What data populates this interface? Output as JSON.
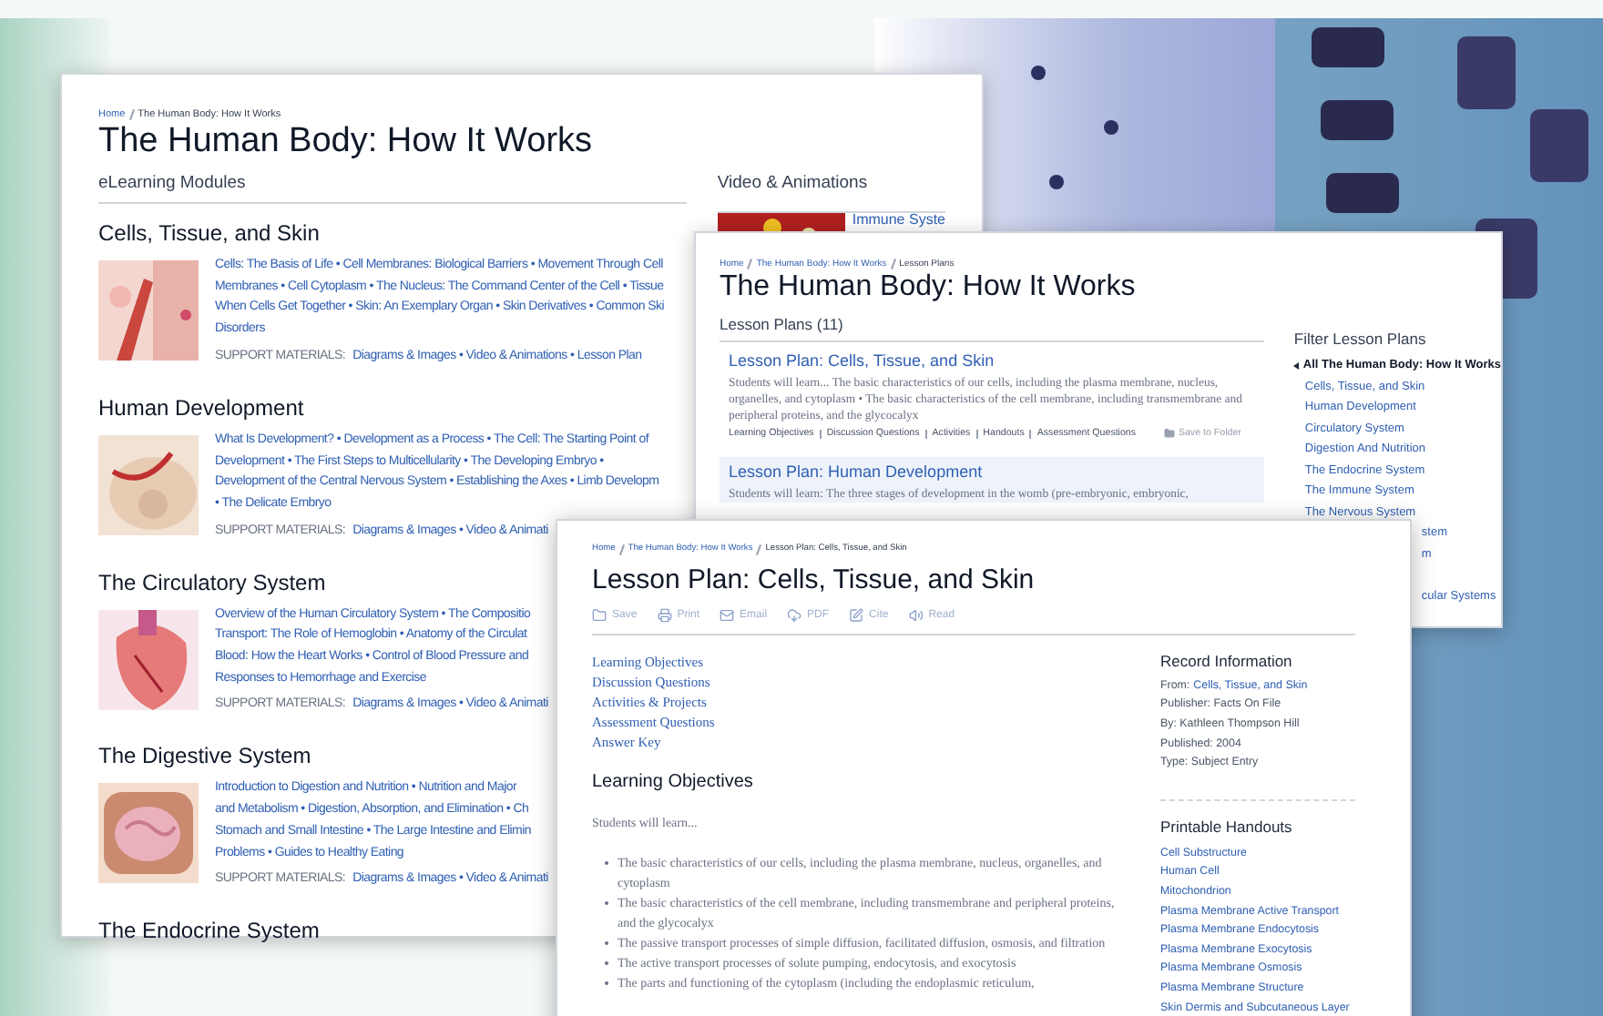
{
  "modules_page": {
    "breadcrumb": [
      {
        "label": "Home",
        "link": true
      },
      {
        "label": "The Human Body: How It Works",
        "link": false
      }
    ],
    "title": "The Human Body: How It Works",
    "section_title": "eLearning Modules",
    "modules": [
      {
        "title": "Cells, Tissue, and Skin",
        "lines": [
          "Cells: The Basis of Life • Cell Membranes: Biological Barriers • Movement Through Cell",
          "Membranes • Cell Cytoplasm • The Nucleus: The Command Center of the Cell • Tissue",
          "When Cells Get Together • Skin: An Exemplary Organ • Skin Derivatives • Common Ski",
          "Disorders"
        ],
        "support_label": "SUPPORT MATERIALS:",
        "support_links": "Diagrams & Images • Video & Animations • Lesson Plan"
      },
      {
        "title": "Human Development",
        "lines": [
          "What Is Development? • Development as a Process • The Cell: The Starting Point of",
          "Development • The First Steps to Multicellularity • The Developing Embryo •",
          "Development of the Central Nervous System • Establishing the Axes • Limb Developm",
          "• The Delicate Embryo"
        ],
        "support_label": "SUPPORT MATERIALS:",
        "support_links": "Diagrams & Images • Video & Animati"
      },
      {
        "title": "The Circulatory System",
        "lines": [
          "Overview of the Human Circulatory System • The Compositio",
          "Transport: The Role of Hemoglobin • Anatomy of the Circulat",
          "Blood: How the Heart Works • Control of Blood Pressure and",
          "Responses to Hemorrhage and Exercise"
        ],
        "support_label": "SUPPORT MATERIALS:",
        "support_links": "Diagrams & Images • Video & Animati"
      },
      {
        "title": "The Digestive System",
        "lines": [
          "Introduction to Digestion and Nutrition • Nutrition and Major",
          "and Metabolism • Digestion, Absorption, and Elimination • Ch",
          "Stomach and Small Intestine • The Large Intestine and Elimin",
          "Problems • Guides to Healthy Eating"
        ],
        "support_label": "SUPPORT MATERIALS:",
        "support_links": "Diagrams & Images • Video & Animati"
      },
      {
        "title": "The Endocrine System"
      }
    ],
    "side_title": "Video & Animations",
    "video_link": "Immune Syste"
  },
  "lesson_plans_page": {
    "breadcrumb": [
      {
        "label": "Home",
        "link": true
      },
      {
        "label": "The Human Body: How It Works",
        "link": true
      },
      {
        "label": "Lesson Plans",
        "link": false
      }
    ],
    "title": "The Human Body: How It Works",
    "list_title": "Lesson Plans (11)",
    "plans": [
      {
        "title": "Lesson Plan: Cells, Tissue, and Skin",
        "description": "Students will learn...  The basic characteristics of our cells, including the plasma membrane, nucleus, organelles, and cytoplasm • The basic characteristics of the cell membrane, including transmembrane and peripheral proteins, and the glycocalyx",
        "links": [
          "Learning Objectives",
          "Discussion Questions",
          "Activities",
          "Handouts",
          "Assessment Questions"
        ],
        "save": "Save to Folder",
        "selected": false
      },
      {
        "title": "Lesson Plan: Human Development",
        "description": "Students will learn: The three stages of development in the womb (pre-embryonic, embryonic,",
        "selected": true
      }
    ],
    "filter_title": "Filter Lesson Plans",
    "filters": [
      {
        "label": "All The Human Body: How It Works",
        "selected": true
      },
      {
        "label": "Cells, Tissue, and Skin",
        "selected": false
      },
      {
        "label": "Human Development",
        "selected": false
      },
      {
        "label": "Circulatory System",
        "selected": false
      },
      {
        "label": "Digestion And Nutrition",
        "selected": false
      },
      {
        "label": "The Endocrine System",
        "selected": false
      },
      {
        "label": "The Immune System",
        "selected": false
      },
      {
        "label": "The Nervous System",
        "selected": false
      },
      {
        "label": "stem",
        "selected": false
      },
      {
        "label": "m",
        "selected": false
      },
      {
        "label": "cular Systems",
        "selected": false
      }
    ]
  },
  "lesson_page": {
    "breadcrumb": [
      {
        "label": "Home",
        "link": true
      },
      {
        "label": "The Human Body: How It Works",
        "link": true
      },
      {
        "label": "Lesson Plan: Cells, Tissue, and Skin",
        "link": false
      }
    ],
    "title": "Lesson Plan: Cells, Tissue, and Skin",
    "tools": [
      "Save",
      "Print",
      "Email",
      "PDF",
      "Cite",
      "Read"
    ],
    "contents": [
      "Learning Objectives",
      "Discussion Questions",
      "Activities & Projects",
      "Assessment Questions",
      "Answer Key"
    ],
    "section_title": "Learning Objectives",
    "intro": "Students will learn...",
    "objectives": [
      "The basic characteristics of our cells, including the plasma membrane, nucleus, organelles, and cytoplasm",
      "The basic characteristics of the cell membrane, including transmembrane and peripheral proteins, and the glycocalyx",
      "The passive transport processes of simple diffusion, facilitated diffusion, osmosis, and filtration",
      "The active transport processes of solute pumping, endocytosis, and exocytosis",
      "The parts and functioning of the cytoplasm (including the endoplasmic reticulum,"
    ],
    "record_title": "Record Information",
    "record": [
      {
        "label": "From:",
        "link": "Cells, Tissue, and Skin"
      },
      {
        "label": "Publisher: Facts On File"
      },
      {
        "label": "By: Kathleen Thompson Hill"
      },
      {
        "label": "Published: 2004"
      },
      {
        "label": "Type: Subject Entry"
      }
    ],
    "handouts_title": "Printable Handouts",
    "handouts": [
      "Cell Substructure",
      "Human Cell",
      "Mitochondrion",
      "Plasma Membrane Active Transport",
      "Plasma Membrane Endocytosis",
      "Plasma Membrane Exocytosis",
      "Plasma Membrane Osmosis",
      "Plasma Membrane Structure",
      "Skin Dermis and Subcutaneous Layer"
    ]
  }
}
